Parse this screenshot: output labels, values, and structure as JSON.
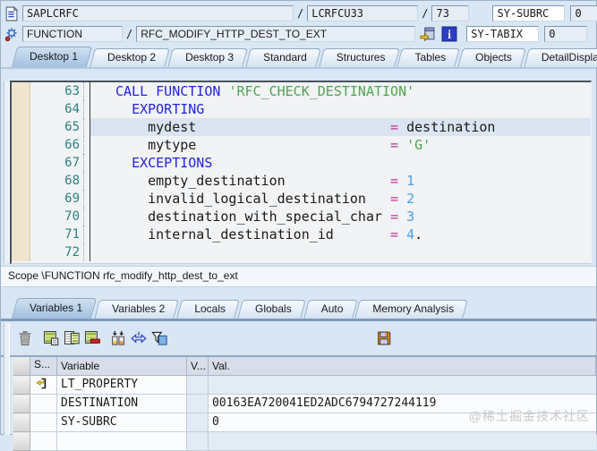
{
  "header": {
    "separator": "/",
    "program_field": {
      "value": "SAPLCRFC"
    },
    "include_field": {
      "value": "LCRFCU33"
    },
    "line_field": {
      "value": "73"
    },
    "sy_subrc": {
      "label": "SY-SUBRC",
      "value": "0"
    },
    "mode_field": {
      "value": "FUNCTION"
    },
    "name_field": {
      "value": "RFC_MODIFY_HTTP_DEST_TO_EXT"
    },
    "sy_tabix": {
      "label": "SY-TABIX",
      "value": "0"
    }
  },
  "desktop_tabs": [
    {
      "label": "Desktop 1",
      "active": true
    },
    {
      "label": "Desktop 2",
      "active": false
    },
    {
      "label": "Desktop 3",
      "active": false
    },
    {
      "label": "Standard",
      "active": false
    },
    {
      "label": "Structures",
      "active": false
    },
    {
      "label": "Tables",
      "active": false
    },
    {
      "label": "Objects",
      "active": false
    },
    {
      "label": "DetailDisplay",
      "active": false
    }
  ],
  "code": {
    "lines": [
      {
        "no": "63",
        "hl": false,
        "seg": [
          [
            "CALL FUNCTION",
            "kw"
          ],
          [
            " ",
            ""
          ],
          [
            "'RFC_CHECK_DESTINATION'",
            "str"
          ]
        ]
      },
      {
        "no": "64",
        "hl": false,
        "seg": [
          [
            "  ",
            ""
          ],
          [
            "EXPORTING",
            "kw"
          ]
        ]
      },
      {
        "no": "65",
        "hl": true,
        "seg": [
          [
            "    mydest                        ",
            ""
          ],
          [
            "=",
            "op"
          ],
          [
            " destination",
            ""
          ]
        ]
      },
      {
        "no": "66",
        "hl": false,
        "seg": [
          [
            "    mytype                        ",
            ""
          ],
          [
            "=",
            "op"
          ],
          [
            " ",
            ""
          ],
          [
            "'G'",
            "str"
          ]
        ]
      },
      {
        "no": "67",
        "hl": false,
        "seg": [
          [
            "  ",
            ""
          ],
          [
            "EXCEPTIONS",
            "kw"
          ]
        ]
      },
      {
        "no": "68",
        "hl": false,
        "seg": [
          [
            "    empty_destination             ",
            ""
          ],
          [
            "=",
            "op"
          ],
          [
            " ",
            ""
          ],
          [
            "1",
            "num"
          ]
        ]
      },
      {
        "no": "69",
        "hl": false,
        "seg": [
          [
            "    invalid_logical_destination   ",
            ""
          ],
          [
            "=",
            "op"
          ],
          [
            " ",
            ""
          ],
          [
            "2",
            "num"
          ]
        ]
      },
      {
        "no": "70",
        "hl": false,
        "seg": [
          [
            "    destination_with_special_char ",
            ""
          ],
          [
            "=",
            "op"
          ],
          [
            " ",
            ""
          ],
          [
            "3",
            "num"
          ]
        ]
      },
      {
        "no": "71",
        "hl": false,
        "seg": [
          [
            "    internal_destination_id       ",
            ""
          ],
          [
            "=",
            "op"
          ],
          [
            " ",
            ""
          ],
          [
            "4",
            "num"
          ],
          [
            ".",
            ""
          ]
        ]
      },
      {
        "no": "72",
        "hl": false,
        "seg": []
      }
    ]
  },
  "scope_text": "Scope \\FUNCTION rfc_modify_http_dest_to_ext",
  "variable_tabs": [
    {
      "label": "Variables 1",
      "active": true
    },
    {
      "label": "Variables 2",
      "active": false
    },
    {
      "label": "Locals",
      "active": false
    },
    {
      "label": "Globals",
      "active": false
    },
    {
      "label": "Auto",
      "active": false
    },
    {
      "label": "Memory Analysis",
      "active": false
    }
  ],
  "toolbar_icons": [
    {
      "name": "delete-icon"
    },
    {
      "name": "table-green-icon"
    },
    {
      "name": "table-page-icon"
    },
    {
      "name": "table-minus-icon"
    },
    {
      "name": "compare-columns-icon"
    },
    {
      "name": "swap-arrow-icon"
    },
    {
      "name": "filter-icon"
    },
    {
      "name": "save-icon"
    }
  ],
  "variables_table": {
    "columns": [
      "S...",
      "Variable",
      "V...",
      "Val."
    ],
    "rows": [
      {
        "icon": "internal-table-icon",
        "variable": "LT_PROPERTY",
        "v": "",
        "val": ""
      },
      {
        "icon": "",
        "variable": "DESTINATION",
        "v": "",
        "val": "00163EA720041ED2ADC6794727244119"
      },
      {
        "icon": "",
        "variable": "SY-SUBRC",
        "v": "",
        "val": "0"
      },
      {
        "icon": "",
        "variable": "",
        "v": "",
        "val": ""
      }
    ]
  },
  "watermark": "@稀土掘金技术社区",
  "colors": {
    "keyword": "#2424d8",
    "string": "#4fa44f",
    "operator": "#b33898",
    "number": "#4b9fe6",
    "line_number": "#2f8080",
    "highlight_line": "#dbe5f1",
    "active_tab": "#a2c1e0"
  }
}
